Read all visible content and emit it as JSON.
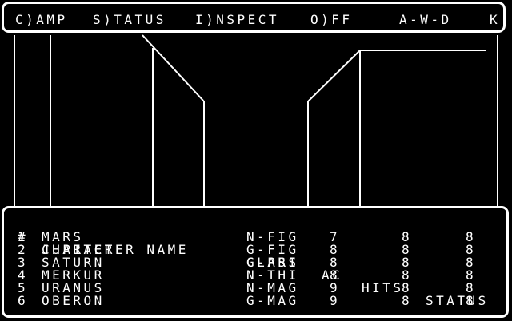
{
  "menu": {
    "camp": "C)AMP",
    "status": "S)TATUS",
    "inspect": "I)NSPECT",
    "off": "O)FF",
    "position": "A-W-D",
    "facing": "K"
  },
  "roster": {
    "headers": {
      "number": "#",
      "name": "CHARACTER NAME",
      "class": "CLASS",
      "ac": "AC",
      "hits": "HITS",
      "status": "STATUS"
    },
    "characters": [
      {
        "number": "1",
        "name": "MARS",
        "class": "N-FIG",
        "ac": "7",
        "hits": "8",
        "status": "8"
      },
      {
        "number": "2",
        "name": "JUPITER",
        "class": "G-FIG",
        "ac": "8",
        "hits": "8",
        "status": "8"
      },
      {
        "number": "3",
        "name": "SATURN",
        "class": "G-PRI",
        "ac": "8",
        "hits": "8",
        "status": "8"
      },
      {
        "number": "4",
        "name": "MERKUR",
        "class": "N-THI",
        "ac": "8",
        "hits": "8",
        "status": "8"
      },
      {
        "number": "5",
        "name": "URANUS",
        "class": "N-MAG",
        "ac": "9",
        "hits": "8",
        "status": "8"
      },
      {
        "number": "6",
        "name": "OBERON",
        "class": "G-MAG",
        "ac": "9",
        "hits": "8",
        "status": "8"
      }
    ]
  },
  "colors": {
    "background": "#000000",
    "foreground": "#ffffff"
  }
}
